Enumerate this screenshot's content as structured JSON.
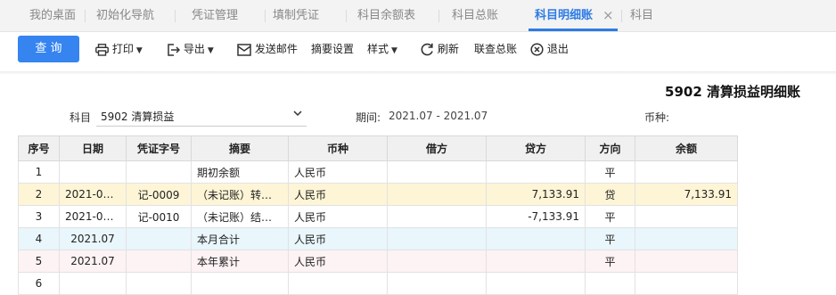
{
  "tabs": [
    {
      "label": "我的桌面"
    },
    {
      "label": "初始化导航"
    },
    {
      "label": "凭证管理"
    },
    {
      "label": "填制凭证"
    },
    {
      "label": "科目余额表"
    },
    {
      "label": "科目总账"
    },
    {
      "label": "科目明细账",
      "close_icon": "×"
    },
    {
      "label": "科目"
    }
  ],
  "toolbar": {
    "query": "查 询",
    "print": "打印",
    "export": "导出",
    "send_mail": "发送邮件",
    "summary_settings": "摘要设置",
    "style": "样式",
    "refresh": "刷新",
    "linked_ledger": "联查总账",
    "exit": "退出"
  },
  "header": {
    "title": "5902 清算损益明细账",
    "subject_label": "科目",
    "subject_value": "5902 清算损益",
    "period_label": "期间:",
    "period_value": "2021.07 - 2021.07",
    "currency_label": "币种:"
  },
  "table": {
    "columns": [
      "序号",
      "日期",
      "凭证字号",
      "摘要",
      "币种",
      "借方",
      "贷方",
      "方向",
      "余额"
    ],
    "rows": [
      {
        "no": "1",
        "date": "",
        "voucher": "",
        "summary": "期初余额",
        "currency": "人民币",
        "debit": "",
        "credit": "",
        "direction": "平",
        "balance": ""
      },
      {
        "no": "2",
        "date": "2021-07…",
        "voucher": "记-0009",
        "summary": "（未记账）转…",
        "currency": "人民币",
        "debit": "",
        "credit": "7,133.91",
        "direction": "贷",
        "balance": "7,133.91"
      },
      {
        "no": "3",
        "date": "2021-07…",
        "voucher": "记-0010",
        "summary": "（未记账）结…",
        "currency": "人民币",
        "debit": "",
        "credit": "-7,133.91",
        "direction": "平",
        "balance": ""
      },
      {
        "no": "4",
        "date": "2021.07",
        "voucher": "",
        "summary": "本月合计",
        "currency": "人民币",
        "debit": "",
        "credit": "",
        "direction": "平",
        "balance": ""
      },
      {
        "no": "5",
        "date": "2021.07",
        "voucher": "",
        "summary": "本年累计",
        "currency": "人民币",
        "debit": "",
        "credit": "",
        "direction": "平",
        "balance": ""
      },
      {
        "no": "6",
        "date": "",
        "voucher": "",
        "summary": "",
        "currency": "",
        "debit": "",
        "credit": "",
        "direction": "",
        "balance": ""
      }
    ]
  },
  "colors": {
    "accent": "#3584f0",
    "negative": "#e3301e",
    "link": "#2046c2"
  }
}
